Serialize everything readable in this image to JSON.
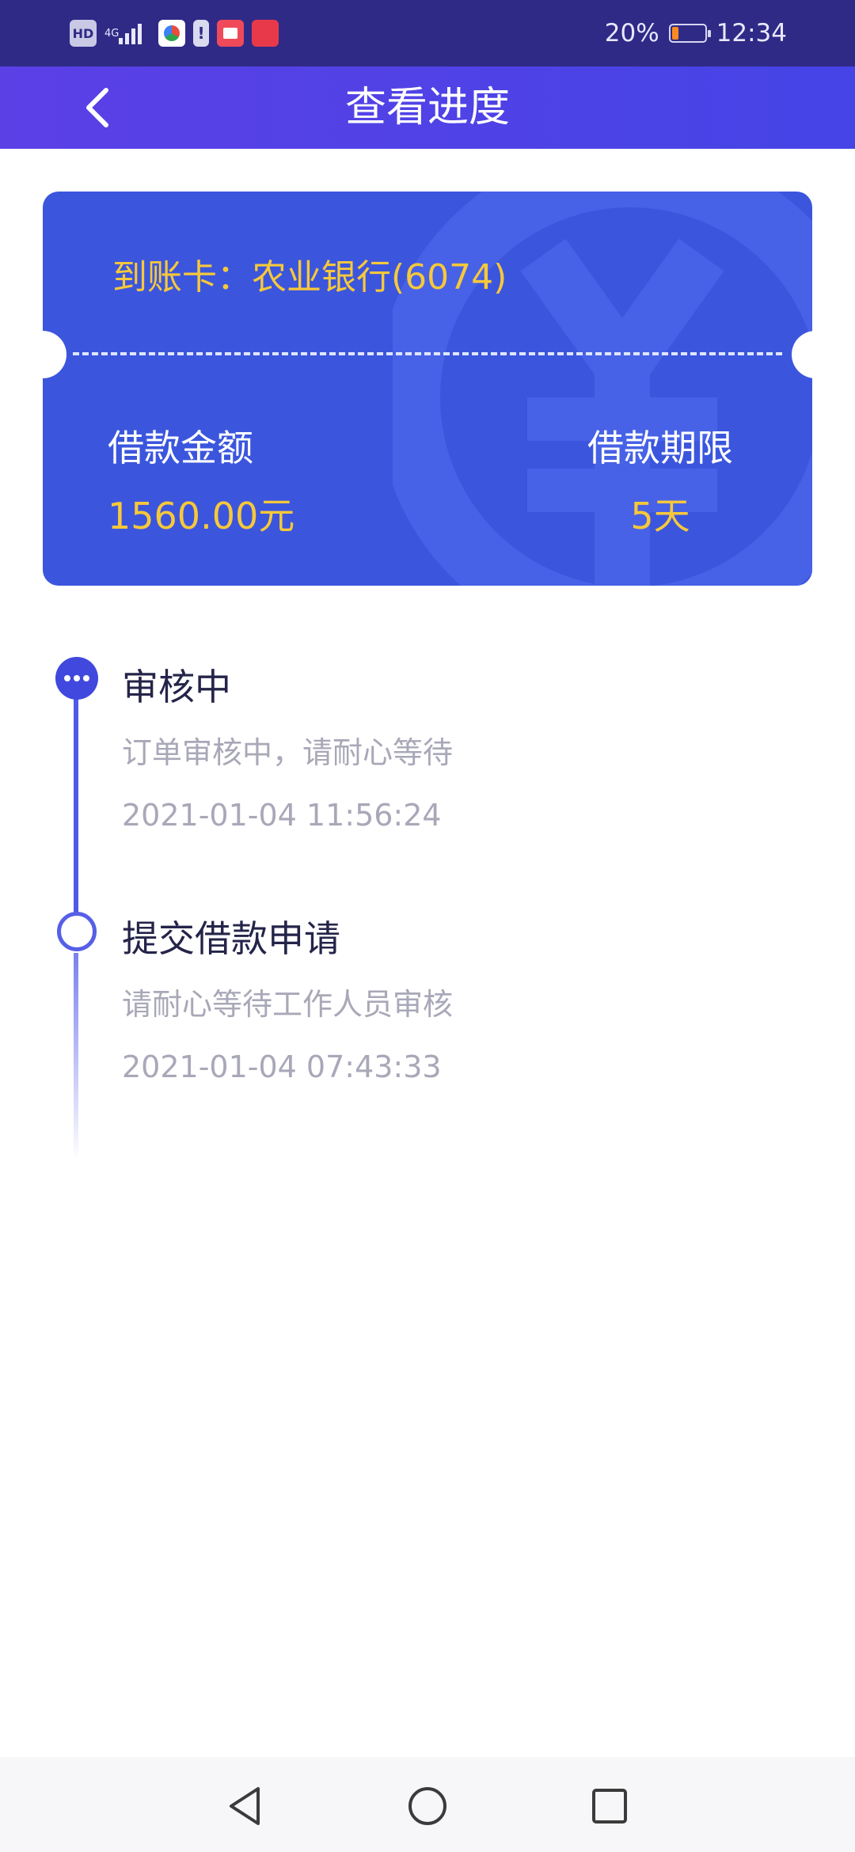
{
  "status_bar": {
    "hd": "HD",
    "network": "4G",
    "battery_percent": "20%",
    "battery_level": 0.2,
    "time": "12:34",
    "app_icons": [
      "hd-icon",
      "network-4g-icon",
      "signal-icon",
      "browser-app-icon",
      "notification-alert-icon",
      "reader-app-icon",
      "huawei-app-icon"
    ]
  },
  "header": {
    "title": "查看进度",
    "back_icon": "chevron-left-icon"
  },
  "card": {
    "bank_line": "到账卡：农业银行(6074)",
    "amount_label": "借款金额",
    "amount_value": "1560.00元",
    "term_label": "借款期限",
    "term_value": "5天",
    "background_icon": "yen-icon",
    "colors": {
      "background": "#3b56dd",
      "highlight": "#f7c83a"
    }
  },
  "timeline": [
    {
      "title": "审核中",
      "desc": "订单审核中，请耐心等待",
      "time": "2021-01-04 11:56:24",
      "icon": "more-dots-icon"
    },
    {
      "title": "提交借款申请",
      "desc": "请耐心等待工作人员审核",
      "time": "2021-01-04 07:43:33",
      "icon": "circle-icon"
    }
  ],
  "navbar": {
    "icons": [
      "nav-back-icon",
      "nav-home-icon",
      "nav-recent-icon"
    ]
  }
}
